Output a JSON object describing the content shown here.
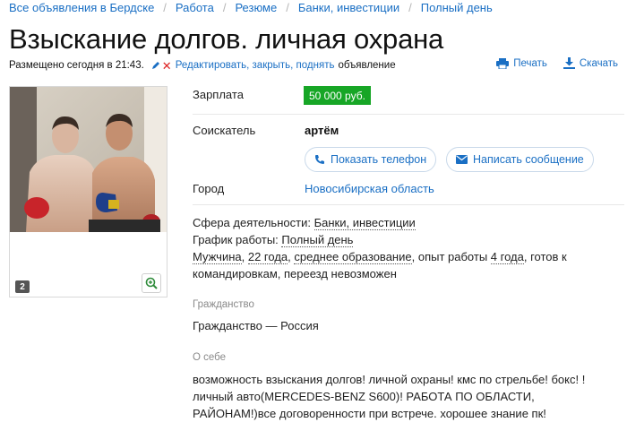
{
  "breadcrumb": [
    "Все объявления в Бердске",
    "Работа",
    "Резюме",
    "Банки, инвестиции",
    "Полный день"
  ],
  "title": "Взыскание долгов. личная охрана",
  "meta": {
    "posted": "Размещено сегодня в 21:43.",
    "edit_link": "Редактировать, закрыть, поднять",
    "edit_tail": "объявление"
  },
  "actions": {
    "print": "Печать",
    "download": "Скачать"
  },
  "photo": {
    "count": "2"
  },
  "fields": {
    "salary_label": "Зарплата",
    "salary_value": "50 000 руб.",
    "seeker_label": "Соискатель",
    "seeker_value": "артём",
    "show_phone": "Показать телефон",
    "write_message": "Написать сообщение",
    "city_label": "Город",
    "city_value": "Новосибирская область"
  },
  "info": {
    "sphere_label": "Сфера деятельности:",
    "sphere_value": "Банки, инвестиции",
    "schedule_label": "График работы:",
    "schedule_value": "Полный день",
    "gender": "Мужчина",
    "age": "22 года",
    "education": "среднее образование",
    "experience_prefix": "опыт работы",
    "experience_value": "4 года",
    "experience_rest": "готов к командировкам, переезд невозможен"
  },
  "citizenship": {
    "title": "Гражданство",
    "value": "Гражданство — Россия"
  },
  "about": {
    "title": "О себе",
    "text": "возможность взыскания долгов! личной охраны! кмс по стрельбе! бокс! ! личный авто(MERCEDES-BENZ S600)! РАБОТА ПО ОБЛАСТИ, РАЙОНАМ!)все договоренности при встрече. хорошее знание пк!"
  },
  "colors": {
    "link": "#1a6fc4",
    "salary_bg": "#17a626",
    "delete": "#dd2222"
  }
}
